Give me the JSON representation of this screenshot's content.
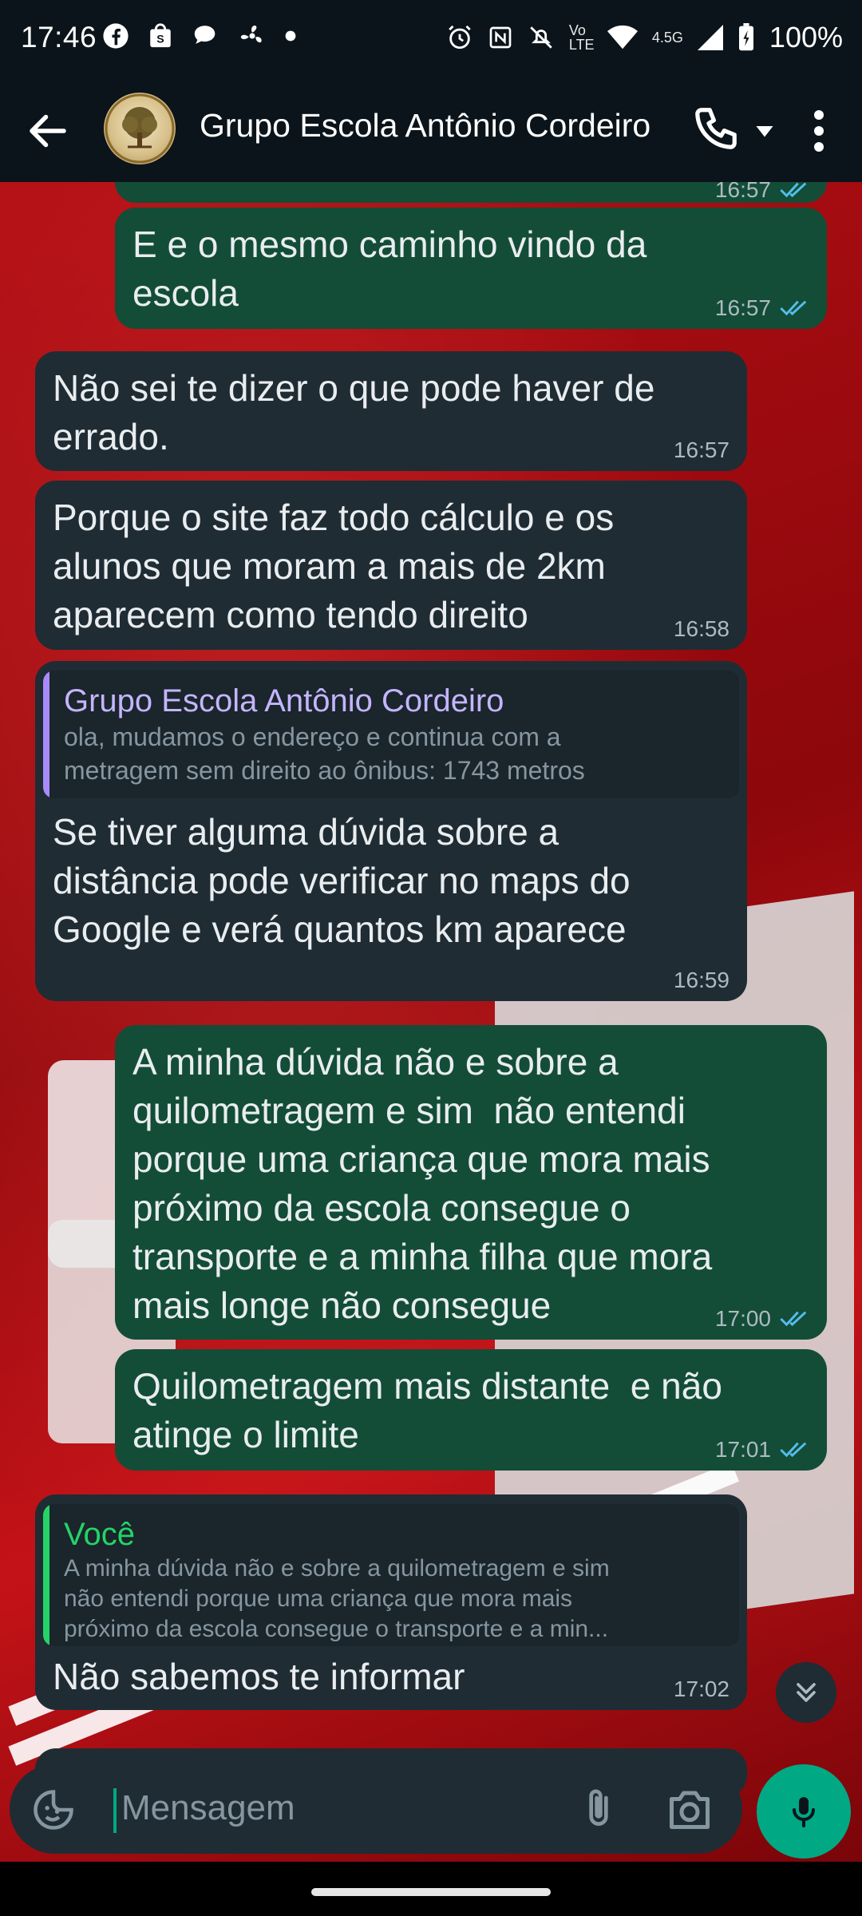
{
  "status_bar": {
    "time": "17:46",
    "left_icons": [
      "facebook-icon",
      "shopping-bag-icon",
      "chat-bubbles-icon",
      "fan-icon",
      "dot-icon"
    ],
    "network": "4.5G",
    "volte": "Vo LTE",
    "battery": "100%"
  },
  "header": {
    "title": "Grupo Escola Antônio Cordeiro",
    "icons": [
      "back-arrow-icon",
      "group-avatar",
      "phone-icon",
      "dropdown-icon",
      "more-vertical-icon"
    ]
  },
  "messages": [
    {
      "dir": "out",
      "time": "16:57",
      "text": ""
    },
    {
      "dir": "out",
      "time": "16:57",
      "text": "E e o mesmo caminho vindo da\nescola"
    },
    {
      "dir": "in",
      "time": "16:57",
      "text": "Não sei te dizer o que pode haver de\nerrado."
    },
    {
      "dir": "in",
      "time": "16:58",
      "text": "Porque o site faz todo cálculo e os\nalunos que moram a mais de 2km\naparecem como tendo direito"
    },
    {
      "dir": "in",
      "time": "16:59",
      "quote": {
        "author": "Grupo Escola Antônio Cordeiro",
        "text": "ola, mudamos o endereço e continua com a\nmetragem sem direito ao ônibus: 1743 metros",
        "color": "#a78bfa"
      },
      "text": "Se tiver alguma dúvida sobre a\ndistância pode verificar no maps do\nGoogle e verá quantos km aparece"
    },
    {
      "dir": "out",
      "time": "17:00",
      "text": "A minha dúvida não e sobre a\nquilometragem e sim  não entendi\nporque uma criança que mora mais\npróximo da escola consegue o\ntransporte e a minha filha que mora\nmais longe não consegue"
    },
    {
      "dir": "out",
      "time": "17:01",
      "text": "Quilometragem mais distante  e não\natinge o limite"
    },
    {
      "dir": "in",
      "time": "17:02",
      "quote": {
        "author": "Você",
        "text": "A minha dúvida não e sobre a quilometragem e sim\nnão entendi porque uma criança que mora mais\npróximo da escola consegue o transporte e a min...",
        "color": "#25d366"
      },
      "text": "Não sabemos te informar"
    }
  ],
  "input": {
    "placeholder": "Mensagem"
  },
  "colors": {
    "outgoing": "#134d37",
    "incoming": "#1f2c34",
    "accent": "#00a884",
    "read_ticks": "#53bdeb"
  }
}
